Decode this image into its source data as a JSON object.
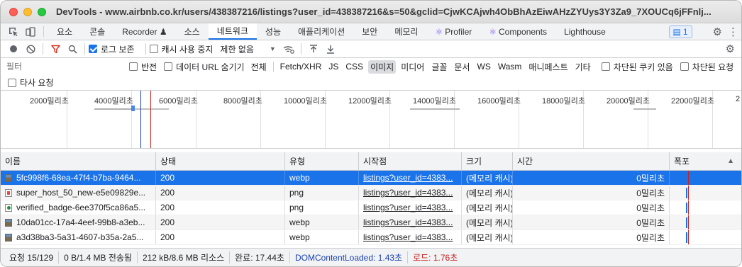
{
  "window": {
    "title": "DevTools - www.airbnb.co.kr/users/438387216/listings?user_id=438387216&s=50&gclid=CjwKCAjwh4ObBhAzEiwAHzZYUys3Y3Za9_7XOUCq6jFFnlj..."
  },
  "tabs": [
    {
      "label": "요소"
    },
    {
      "label": "콘솔"
    },
    {
      "label": "Recorder ♟"
    },
    {
      "label": "소스"
    },
    {
      "label": "네트워크"
    },
    {
      "label": "성능"
    },
    {
      "label": "애플리케이션"
    },
    {
      "label": "보안"
    },
    {
      "label": "메모리"
    },
    {
      "label": "Profiler"
    },
    {
      "label": "Components"
    },
    {
      "label": "Lighthouse"
    }
  ],
  "issues_count": "1",
  "toolbar": {
    "preserve_log": "로그 보존",
    "disable_cache": "캐시 사용 중지",
    "throttle": "제한 없음"
  },
  "filter": {
    "placeholder": "필터",
    "invert": "반전",
    "hide_data_urls": "데이터 URL 숨기기",
    "types": [
      "전체",
      "Fetch/XHR",
      "JS",
      "CSS",
      "이미지",
      "미디어",
      "글꼴",
      "문서",
      "WS",
      "Wasm",
      "매니페스트",
      "기타"
    ],
    "active_type": "이미지",
    "blocked_cookies": "차단된 쿠키 있음",
    "blocked_requests": "차단된 요청",
    "third_party": "타사 요청"
  },
  "overview": {
    "ticks": [
      "2000밀리초",
      "4000밀리초",
      "6000밀리초",
      "8000밀리초",
      "10000밀리초",
      "12000밀리초",
      "14000밀리초",
      "16000밀리초",
      "18000밀리초",
      "20000밀리초",
      "22000밀리초",
      "2"
    ]
  },
  "table": {
    "columns": [
      "이름",
      "상태",
      "유형",
      "시작점",
      "크기",
      "시간",
      "폭포"
    ],
    "rows": [
      {
        "name": "5fc998f6-68ea-47f4-b7ba-9464...",
        "status": "200",
        "type": "webp",
        "initiator": "listings?user_id=4383...",
        "size": "(메모리 캐시)",
        "time": "0밀리초",
        "icon": "webp"
      },
      {
        "name": "super_host_50_new-e5e09829e...",
        "status": "200",
        "type": "png",
        "initiator": "listings?user_id=4383...",
        "size": "(메모리 캐시)",
        "time": "0밀리초",
        "icon": "png-red"
      },
      {
        "name": "verified_badge-6ee370f5ca86a5...",
        "status": "200",
        "type": "png",
        "initiator": "listings?user_id=4383...",
        "size": "(메모리 캐시)",
        "time": "0밀리초",
        "icon": "png-green"
      },
      {
        "name": "10da01cc-17a4-4eef-99b8-a3eb...",
        "status": "200",
        "type": "webp",
        "initiator": "listings?user_id=4383...",
        "size": "(메모리 캐시)",
        "time": "0밀리초",
        "icon": "webp"
      },
      {
        "name": "a3d38ba3-5a31-4607-b35a-2a5...",
        "status": "200",
        "type": "webp",
        "initiator": "listings?user_id=4383...",
        "size": "(메모리 캐시)",
        "time": "0밀리초",
        "icon": "webp"
      }
    ]
  },
  "status": {
    "requests": "요청 15/129",
    "transferred": "0 B/1.4 MB 전송됨",
    "resources": "212 kB/8.6 MB 리소스",
    "finish": "완료: 17.44초",
    "dcl": "DOMContentLoaded: 1.43초",
    "load": "로드: 1.76초"
  },
  "colors": {
    "accent": "#1a73e8",
    "load_red": "#c5221f",
    "dcl_blue": "#1a3fb5"
  }
}
